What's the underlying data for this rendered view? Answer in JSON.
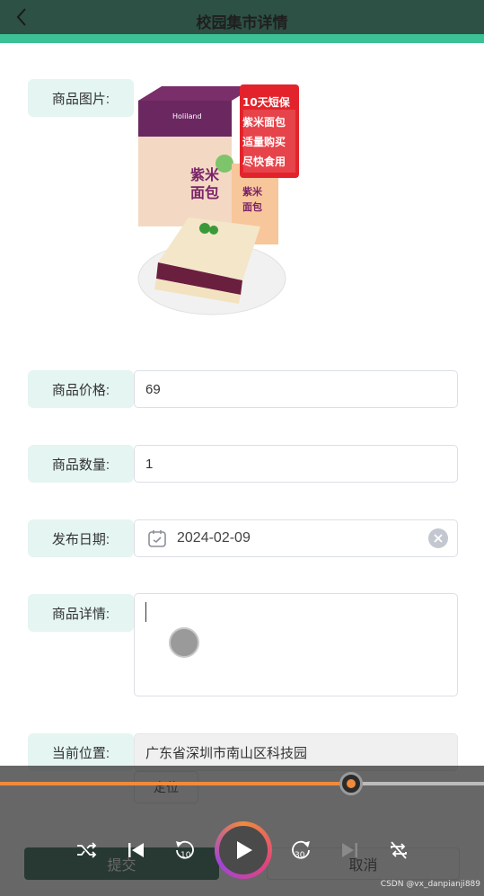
{
  "header": {
    "title": "校园集市详情",
    "back_icon": "chevron-left-icon"
  },
  "form": {
    "image_label": "商品图片:",
    "price_label": "商品价格:",
    "price_value": "69",
    "qty_label": "商品数量:",
    "qty_value": "1",
    "date_label": "发布日期:",
    "date_value": "2024-02-09",
    "detail_label": "商品详情:",
    "detail_value": "",
    "location_label": "当前位置:",
    "location_value": "广东省深圳市南山区科技园",
    "locate_button": "定位"
  },
  "product_image": {
    "brand": "Holiland",
    "box_text_1": "紫米",
    "box_text_2": "面包",
    "tag_lines": [
      "10天短保",
      "紫米面包",
      "适量购买",
      "尽快食用"
    ]
  },
  "actions": {
    "submit": "提交",
    "cancel": "取消"
  },
  "player": {
    "progress_fraction": 0.725,
    "skip_back_label": "10",
    "skip_forward_label": "30",
    "accent_color": "#f08a3c"
  },
  "watermark": "CSDN @vx_danpianji889",
  "colors": {
    "header": "#2d5144",
    "accent": "#3cc196",
    "label_bg": "#e4f5f2",
    "submit": "#1f5a47"
  }
}
